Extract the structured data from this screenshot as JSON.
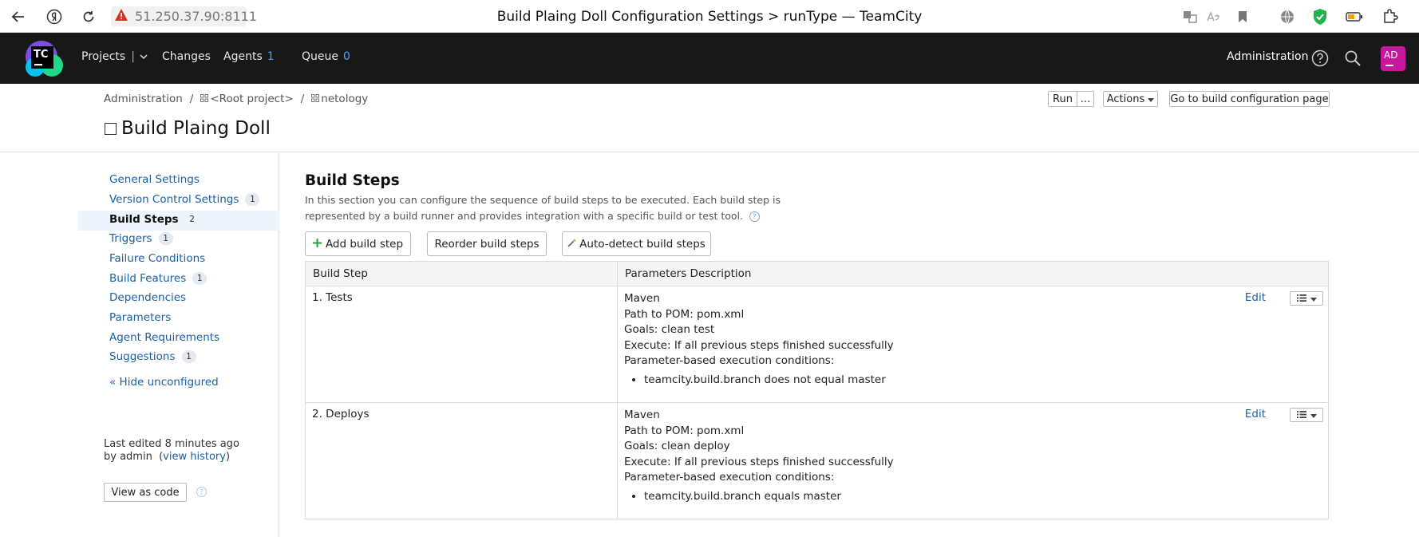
{
  "browser": {
    "url": "51.250.37.90:8111",
    "window_title": "Build Plaing Doll Configuration Settings > runType — TeamCity"
  },
  "header": {
    "logo_text": "TC",
    "nav": {
      "projects": "Projects",
      "changes": "Changes",
      "agents": "Agents",
      "agents_count": "1",
      "queue": "Queue",
      "queue_count": "0"
    },
    "administration": "Administration",
    "avatar_initials": "AD"
  },
  "breadcrumb": [
    "Administration",
    "<Root project>",
    "netology"
  ],
  "page_title": "Build Plaing Doll",
  "toolbar": {
    "run": "Run",
    "run_more": "...",
    "actions": "Actions",
    "goto": "Go to build configuration page"
  },
  "sidebar": {
    "items": [
      {
        "label": "General Settings",
        "badge": ""
      },
      {
        "label": "Version Control Settings",
        "badge": "1"
      },
      {
        "label": "Build Steps",
        "badge": "2"
      },
      {
        "label": "Triggers",
        "badge": "1"
      },
      {
        "label": "Failure Conditions",
        "badge": ""
      },
      {
        "label": "Build Features",
        "badge": "1"
      },
      {
        "label": "Dependencies",
        "badge": ""
      },
      {
        "label": "Parameters",
        "badge": ""
      },
      {
        "label": "Agent Requirements",
        "badge": ""
      },
      {
        "label": "Suggestions",
        "badge": "1"
      }
    ],
    "hide_unconfigured": "« Hide unconfigured",
    "last_edited_label": "Last edited",
    "last_edited_time": "8 minutes ago",
    "by_user": "by admin",
    "view_history": "view history",
    "view_as_code": "View as code"
  },
  "main": {
    "title": "Build Steps",
    "description": "In this section you can configure the sequence of build steps to be executed. Each build step is represented by a build runner and provides integration with a specific build or test tool.",
    "buttons": {
      "add": "Add build step",
      "reorder": "Reorder build steps",
      "autodetect": "Auto-detect build steps"
    },
    "table": {
      "col_step": "Build Step",
      "col_params": "Parameters Description",
      "edit": "Edit",
      "rows": [
        {
          "step": "1. Tests",
          "runner": "Maven",
          "pom": "Path to POM: pom.xml",
          "goals": "Goals: clean test",
          "execute": "Execute: If all previous steps finished successfully",
          "conditions_label": "Parameter-based execution conditions:",
          "condition": "teamcity.build.branch does not equal master"
        },
        {
          "step": "2. Deploys",
          "runner": "Maven",
          "pom": "Path to POM: pom.xml",
          "goals": "Goals: clean deploy",
          "execute": "Execute: If all previous steps finished successfully",
          "conditions_label": "Parameter-based execution conditions:",
          "condition": "teamcity.build.branch equals master"
        }
      ]
    }
  }
}
